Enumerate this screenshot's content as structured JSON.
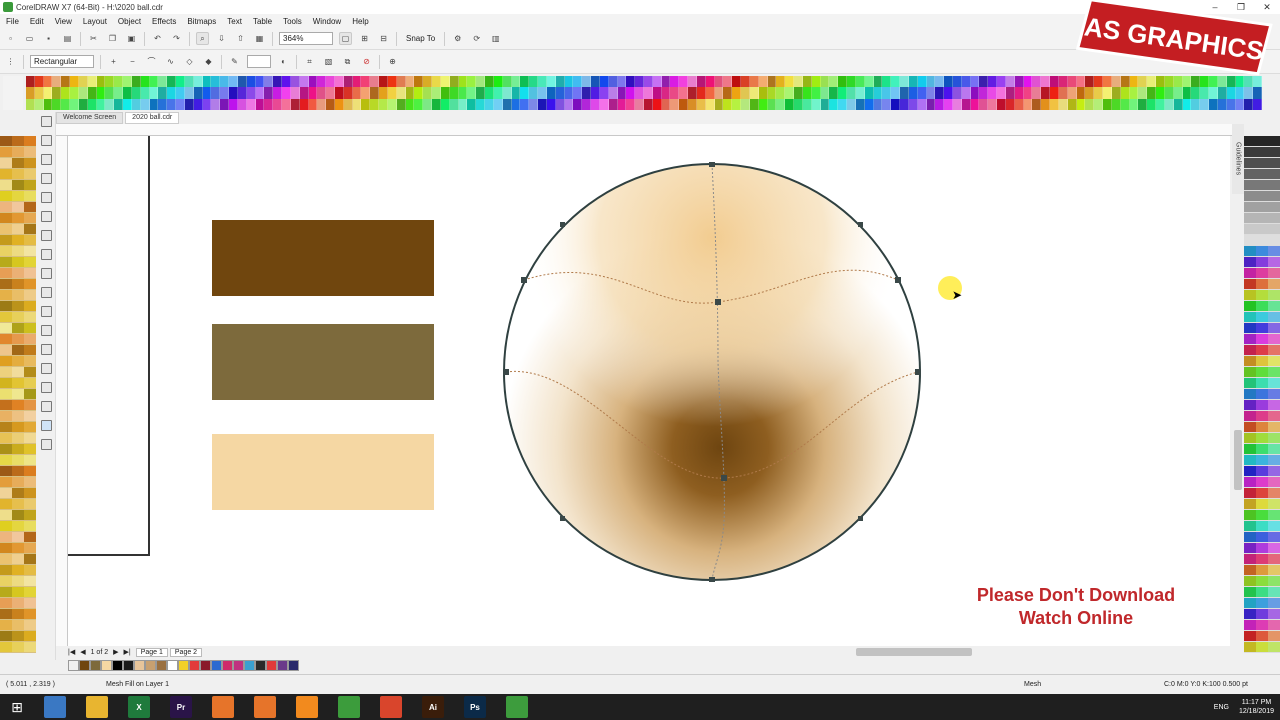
{
  "window": {
    "title": "CorelDRAW X7 (64-Bit) - H:\\2020 ball.cdr",
    "controls": [
      "–",
      "❐",
      "✕"
    ]
  },
  "menu": [
    "File",
    "Edit",
    "View",
    "Layout",
    "Object",
    "Effects",
    "Bitmaps",
    "Text",
    "Table",
    "Tools",
    "Window",
    "Help"
  ],
  "toolbar": {
    "zoom_value": "364%",
    "snap_to_label": "Snap To",
    "shape_type": "Rectangular"
  },
  "tabs": [
    {
      "label": "Welcome Screen",
      "active": false
    },
    {
      "label": "2020 ball.cdr",
      "active": true
    }
  ],
  "docker": {
    "label": "Guidelines"
  },
  "watermark": {
    "line1": "Please Don't Download",
    "line2": "Watch Online"
  },
  "logo": {
    "text": "AS GRAPHICS"
  },
  "page_nav": {
    "count": "1 of 2",
    "pages": [
      "Page 1",
      "Page 2"
    ]
  },
  "status": {
    "coords": "( 5.011 , 2.319 )",
    "message": "Mesh Fill on Layer 1",
    "fill": "Mesh",
    "outline": "C:0 M:0 Y:0 K:100  0.500 pt"
  },
  "taskbar": {
    "apps": [
      {
        "label": "",
        "color": "#3a78c3"
      },
      {
        "label": "",
        "color": "#e8b530"
      },
      {
        "label": "X",
        "color": "#1f7a3c"
      },
      {
        "label": "Pr",
        "color": "#2a1448"
      },
      {
        "label": "",
        "color": "#e6742a"
      },
      {
        "label": "",
        "color": "#e6742a"
      },
      {
        "label": "",
        "color": "#f28a1e"
      },
      {
        "label": "",
        "color": "#3c9c3c"
      },
      {
        "label": "",
        "color": "#d9452c"
      },
      {
        "label": "Ai",
        "color": "#3a1d0a"
      },
      {
        "label": "Ps",
        "color": "#0b2a48"
      },
      {
        "label": "",
        "color": "#3d9c3d"
      }
    ],
    "lang": "ENG",
    "time": "11:17 PM",
    "date": "12/18/2019"
  },
  "colors": {
    "swatch_dark": "#70460e",
    "swatch_mid": "#7d6a3c",
    "swatch_light": "#f5d7a3",
    "watermark": "#c0282b"
  }
}
